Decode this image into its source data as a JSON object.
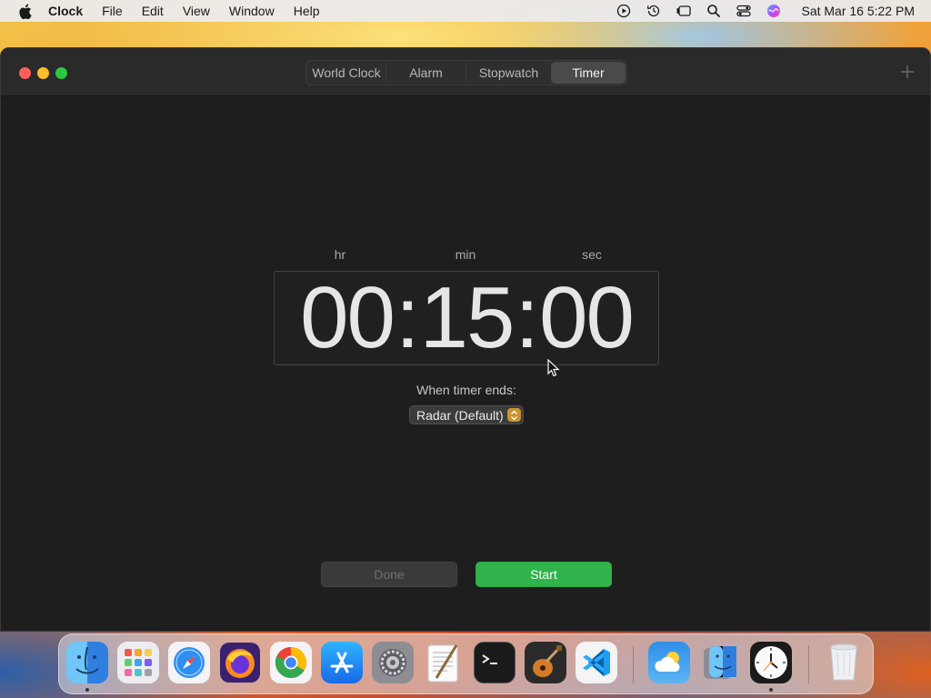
{
  "menubar": {
    "app_name": "Clock",
    "items": [
      "File",
      "Edit",
      "View",
      "Window",
      "Help"
    ],
    "datetime": "Sat Mar 16  5:22 PM"
  },
  "window": {
    "tabs": [
      {
        "label": "World Clock",
        "active": false
      },
      {
        "label": "Alarm",
        "active": false
      },
      {
        "label": "Stopwatch",
        "active": false
      },
      {
        "label": "Timer",
        "active": true
      }
    ],
    "timer": {
      "units": {
        "hr": "hr",
        "min": "min",
        "sec": "sec"
      },
      "hours": "00",
      "minutes": "15",
      "seconds": "00",
      "separator": ":"
    },
    "ends_label": "When timer ends:",
    "sound_selected": "Radar (Default)",
    "done_label": "Done",
    "start_label": "Start"
  },
  "dock": {
    "apps": [
      {
        "name": "Finder",
        "icon": "finder-icon",
        "running": true
      },
      {
        "name": "Launchpad",
        "icon": "launchpad-icon",
        "running": false
      },
      {
        "name": "Safari",
        "icon": "safari-icon",
        "running": false
      },
      {
        "name": "Firefox",
        "icon": "firefox-icon",
        "running": false
      },
      {
        "name": "Chrome",
        "icon": "chrome-icon",
        "running": false
      },
      {
        "name": "App Store",
        "icon": "app-store-icon",
        "running": false
      },
      {
        "name": "System Settings",
        "icon": "settings-icon",
        "running": false
      },
      {
        "name": "TextEdit",
        "icon": "textedit-icon",
        "running": false
      },
      {
        "name": "Terminal",
        "icon": "terminal-icon",
        "running": false
      },
      {
        "name": "GarageBand",
        "icon": "garageband-icon",
        "running": false
      },
      {
        "name": "VS Code",
        "icon": "vscode-icon",
        "running": false
      },
      {
        "name": "Weather",
        "icon": "weather-icon",
        "running": false
      },
      {
        "name": "Finder Recent",
        "icon": "finder-recent-icon",
        "running": false
      },
      {
        "name": "Clock",
        "icon": "clock-icon",
        "running": true
      },
      {
        "name": "Trash",
        "icon": "trash-icon",
        "running": false
      }
    ]
  },
  "colors": {
    "start_green": "#2fb34a",
    "window_bg": "#1e1e1e",
    "close": "#ff5f57",
    "minimize": "#febc2e",
    "maximize": "#28c840"
  }
}
